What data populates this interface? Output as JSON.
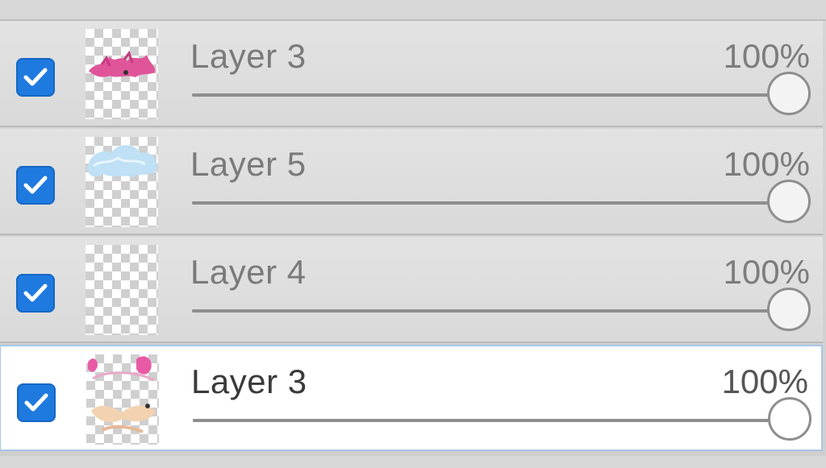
{
  "layers_panel": {
    "layers": [
      {
        "name": "Layer 3",
        "opacity_label": "100%",
        "opacity": 1.0,
        "visible": true,
        "selected": false,
        "thumb": "pink-scribble"
      },
      {
        "name": "Layer 5",
        "opacity_label": "100%",
        "opacity": 1.0,
        "visible": true,
        "selected": false,
        "thumb": "blue-cloud"
      },
      {
        "name": "Layer 4",
        "opacity_label": "100%",
        "opacity": 1.0,
        "visible": true,
        "selected": false,
        "thumb": "empty"
      },
      {
        "name": "Layer 3",
        "opacity_label": "100%",
        "opacity": 1.0,
        "visible": true,
        "selected": true,
        "thumb": "character-sketch"
      }
    ]
  },
  "icons": {
    "visibility": "checkmark-icon"
  },
  "colors": {
    "checkbox": "#1f7ae0",
    "selected_border": "#a9c4e8",
    "selected_background": "#ffffff"
  }
}
